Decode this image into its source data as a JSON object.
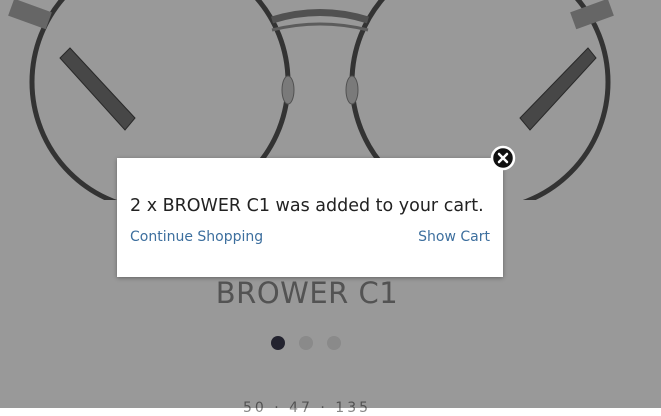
{
  "product": {
    "name": "BROWER C1",
    "sizes": "50 · 47 · 135",
    "carousel": {
      "count": 3,
      "active_index": 0
    }
  },
  "modal": {
    "message": "2 x BROWER C1 was added to your cart.",
    "continue_label": "Continue Shopping",
    "show_cart_label": "Show Cart",
    "close_icon": "close-icon"
  },
  "colors": {
    "link": "#3d6f9e",
    "overlay": "rgba(0,0,0,0.4)",
    "active_dot": "#3b3b4f"
  }
}
